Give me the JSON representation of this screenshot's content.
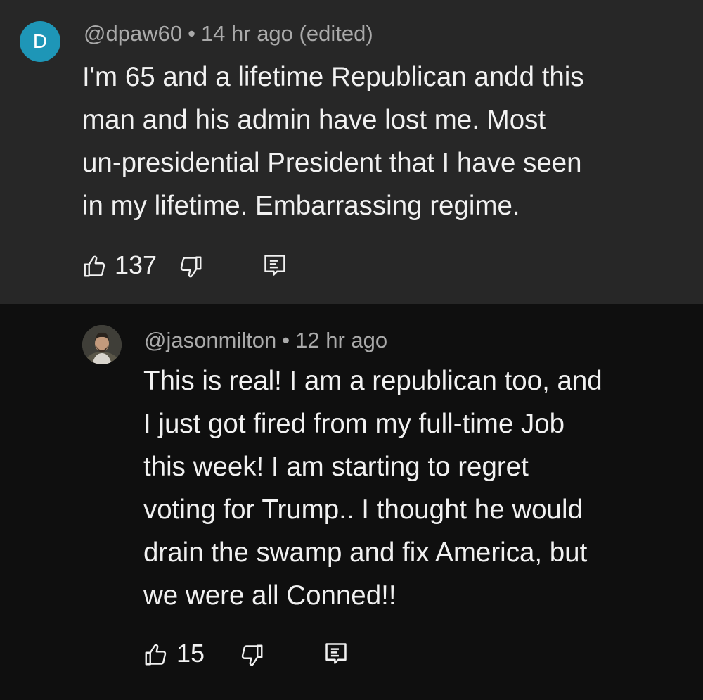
{
  "comments": [
    {
      "avatar_letter": "D",
      "avatar_color": "#1e96b7",
      "handle": "@dpaw60",
      "separator": "•",
      "time": "14 hr ago (edited)",
      "text_lines": [
        "I'm 65 and a lifetime Republican andd this",
        "man and his admin have lost me. Most",
        "un-presidential President that I have seen",
        "in my lifetime. Embarrassing regime."
      ],
      "like_count": "137",
      "icons": {
        "like": "thumbs-up-icon",
        "dislike": "thumbs-down-icon",
        "reply": "reply-icon"
      }
    },
    {
      "avatar": "profile-photo",
      "handle": "@jasonmilton",
      "separator": "•",
      "time": "12 hr ago",
      "text_lines": [
        "This is real! I am a republican too, and",
        "I just got fired from my full-time Job",
        "this week! I am starting to regret",
        "voting for Trump.. I thought he would",
        "drain the swamp and fix America, but",
        "we were all Conned!!"
      ],
      "like_count": "15",
      "icons": {
        "like": "thumbs-up-icon",
        "dislike": "thumbs-down-icon",
        "reply": "reply-icon"
      }
    }
  ],
  "colors": {
    "top_background": "#272727",
    "reply_background": "#0f0f0f",
    "text": "#f1f1f1",
    "meta": "#aaaaaa"
  }
}
